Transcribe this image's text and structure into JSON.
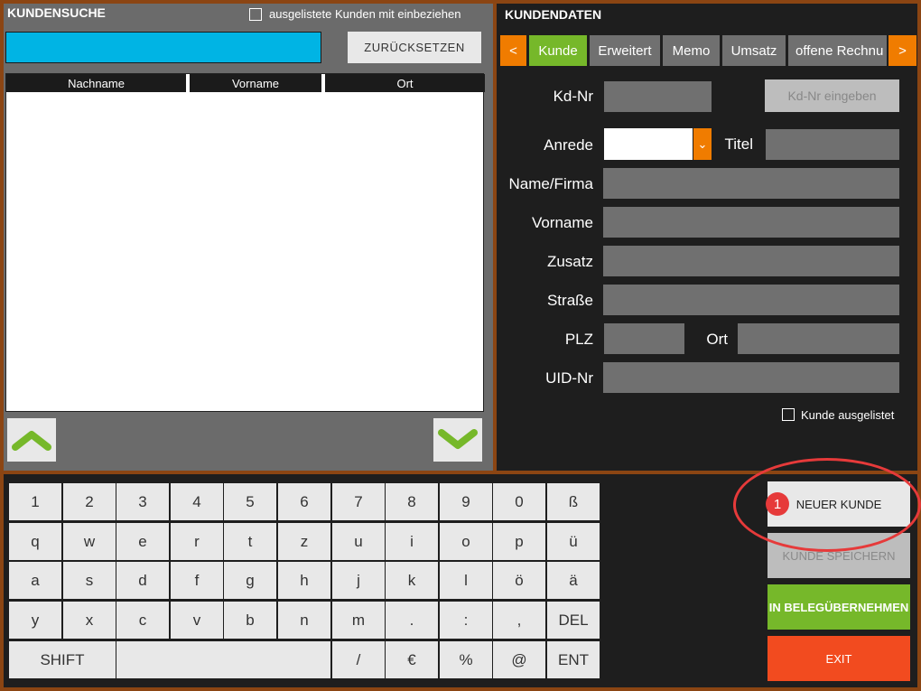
{
  "search": {
    "title": "KUNDENSUCHE",
    "include_delisted_label": "ausgelistete Kunden mit einbeziehen",
    "include_delisted_checked": false,
    "search_value": "",
    "reset_label": "ZURÜCKSETZEN",
    "columns": [
      "Nachname",
      "Vorname",
      "Ort"
    ],
    "rows": []
  },
  "details": {
    "title": "KUNDENDATEN",
    "tabs": [
      {
        "label": "<"
      },
      {
        "label": "Kunde",
        "active": true
      },
      {
        "label": "Erweitert"
      },
      {
        "label": "Memo"
      },
      {
        "label": "Umsatz"
      },
      {
        "label": "offene Rechnu"
      },
      {
        "label": ">"
      }
    ],
    "fields": {
      "kdnr_label": "Kd-Nr",
      "kdnr_button": "Kd-Nr eingeben",
      "anrede_label": "Anrede",
      "titel_label": "Titel",
      "name_label": "Name/Firma",
      "vorname_label": "Vorname",
      "zusatz_label": "Zusatz",
      "strasse_label": "Straße",
      "plz_label": "PLZ",
      "ort_label": "Ort",
      "uid_label": "UID-Nr"
    },
    "delisted_label": "Kunde ausgelistet",
    "delisted_checked": false
  },
  "keyboard": {
    "rows": [
      [
        "1",
        "2",
        "3",
        "4",
        "5",
        "6",
        "7",
        "8",
        "9",
        "0",
        "ß"
      ],
      [
        "q",
        "w",
        "e",
        "r",
        "t",
        "z",
        "u",
        "i",
        "o",
        "p",
        "ü"
      ],
      [
        "a",
        "s",
        "d",
        "f",
        "g",
        "h",
        "j",
        "k",
        "l",
        "ö",
        "ä"
      ],
      [
        "y",
        "x",
        "c",
        "v",
        "b",
        "n",
        "m",
        ".",
        ":",
        ",",
        "DEL"
      ],
      [
        "SHIFT",
        "",
        "/",
        "€",
        "%",
        "@",
        "ENT"
      ]
    ]
  },
  "actions": {
    "new_customer": "NEUER KUNDE",
    "save_customer": "KUNDE SPEICHERN",
    "apply_line1": "IN BELEG",
    "apply_line2": "ÜBERNEHMEN",
    "exit": "EXIT"
  },
  "annotation": {
    "step": "1"
  },
  "colors": {
    "accent_green": "#76b82a",
    "accent_orange": "#f07c00",
    "search_blue": "#00b4e4",
    "exit_red": "#f24b1f",
    "frame": "#8b4513"
  }
}
